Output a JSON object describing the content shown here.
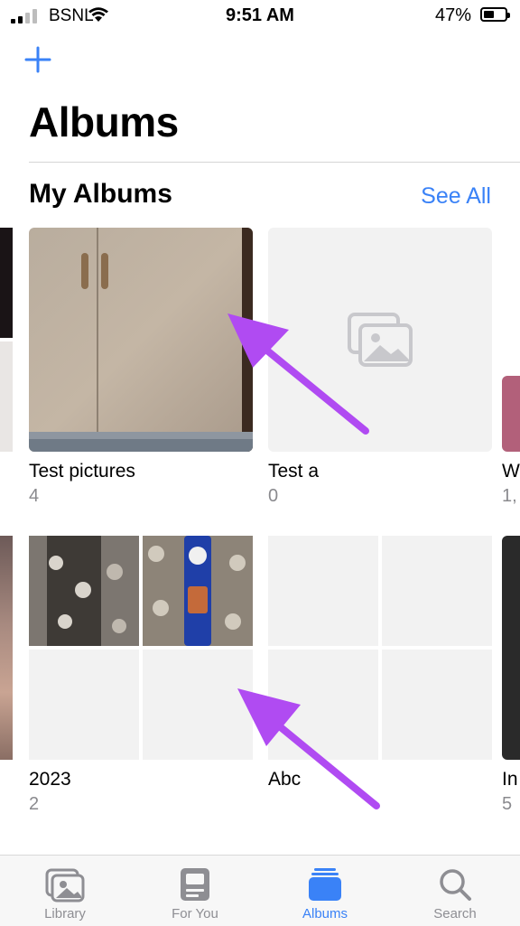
{
  "status_bar": {
    "carrier": "BSNL",
    "time": "9:51 AM",
    "battery": "47%"
  },
  "header": {
    "title": "Albums"
  },
  "my_albums": {
    "title": "My Albums",
    "see_all": "See All",
    "albums": [
      {
        "name": "Test pictures",
        "count": "4"
      },
      {
        "name": "Test a",
        "count": "0"
      },
      {
        "name": "W",
        "count": "1,"
      },
      {
        "name": "2023",
        "count": "2"
      },
      {
        "name": "Abc",
        "count": ""
      },
      {
        "name": "In",
        "count": "5"
      }
    ]
  },
  "tab_bar": {
    "tabs": [
      {
        "label": "Library",
        "icon": "photo-library-icon"
      },
      {
        "label": "For You",
        "icon": "for-you-icon"
      },
      {
        "label": "Albums",
        "icon": "albums-icon"
      },
      {
        "label": "Search",
        "icon": "magnifier-icon"
      }
    ],
    "active": "Albums"
  },
  "colors": {
    "accent": "#3a82f7",
    "annotation_arrow": "#b04bf2"
  }
}
